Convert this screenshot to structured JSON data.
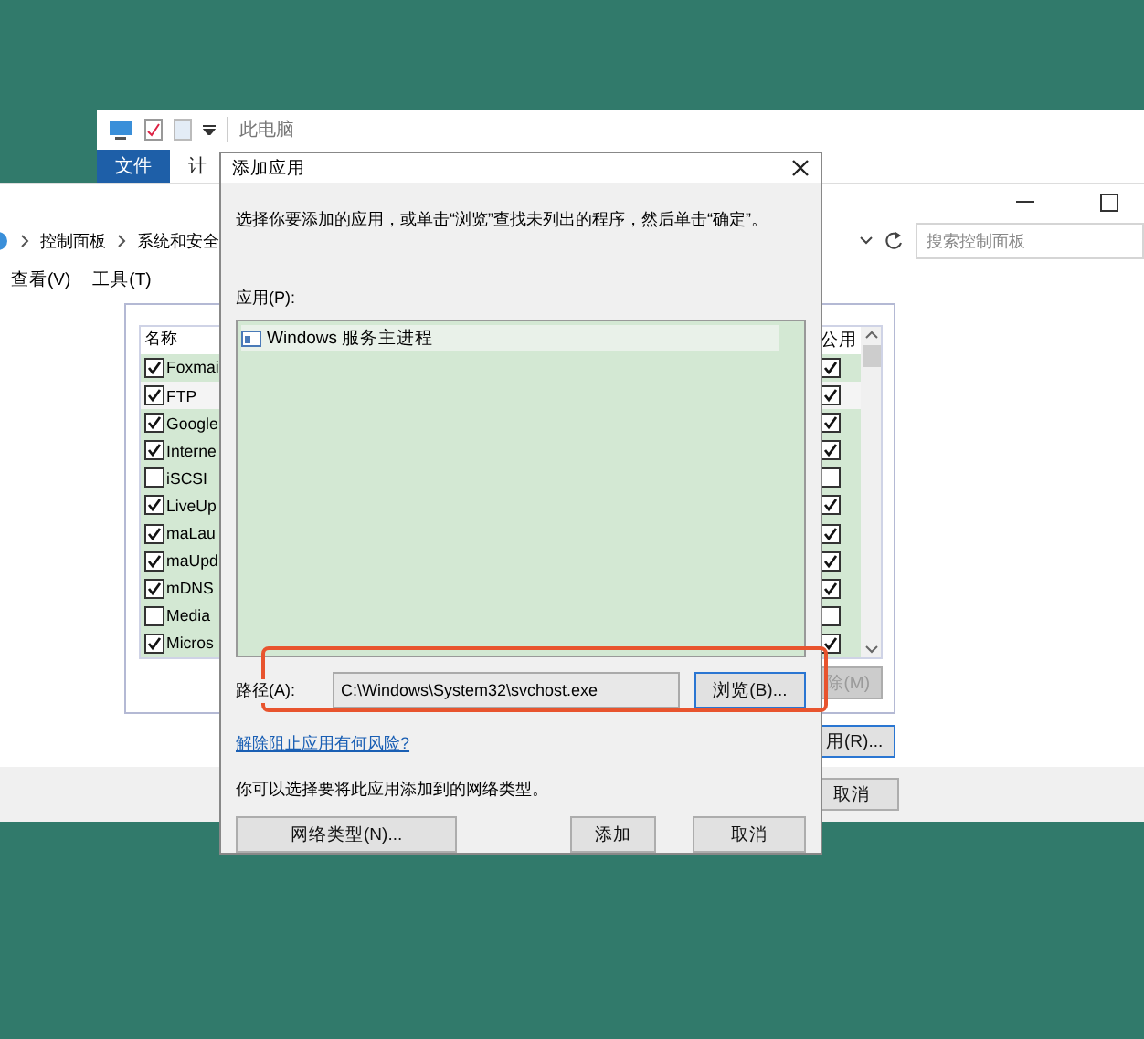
{
  "explorer_window": {
    "title": "此电脑",
    "ribbon_tabs": [
      {
        "label": "文件",
        "selected": true
      },
      {
        "label": "计",
        "selected": false
      }
    ]
  },
  "control_panel": {
    "breadcrumb": [
      "控制面板",
      "系统和安全"
    ],
    "search": {
      "placeholder": "搜索控制面板"
    },
    "menu": [
      "查看(V)",
      "工具(T)"
    ],
    "apps_table": {
      "columns": [
        "名称",
        "公用"
      ],
      "rows": [
        {
          "name": "Foxmai",
          "checked": true,
          "public": true,
          "selected": false
        },
        {
          "name": "FTP",
          "checked": true,
          "public": true,
          "selected": true
        },
        {
          "name": "Google",
          "checked": true,
          "public": true,
          "selected": false
        },
        {
          "name": "Interne",
          "checked": true,
          "public": true,
          "selected": false
        },
        {
          "name": "iSCSI",
          "checked": false,
          "public": false,
          "selected": false
        },
        {
          "name": "LiveUp",
          "checked": true,
          "public": true,
          "selected": false
        },
        {
          "name": "maLau",
          "checked": true,
          "public": true,
          "selected": false
        },
        {
          "name": "maUpd",
          "checked": true,
          "public": true,
          "selected": false
        },
        {
          "name": "mDNS",
          "checked": true,
          "public": true,
          "selected": false
        },
        {
          "name": "Media",
          "checked": false,
          "public": false,
          "selected": false
        },
        {
          "name": "Micros",
          "checked": true,
          "public": true,
          "selected": false
        }
      ]
    },
    "remove_button": {
      "label": "除(M)",
      "disabled": true
    },
    "allow_button": {
      "label": "用(R)...",
      "disabled": false
    },
    "cancel_button": "取消"
  },
  "dialog": {
    "title": "添加应用",
    "instruction": "选择你要添加的应用，或单击“浏览”查找未列出的程序，然后单击“确定”。",
    "apps_label": "应用(P):",
    "apps": [
      {
        "name": "Windows 服务主进程",
        "selected": true
      }
    ],
    "path_label": "路径(A):",
    "path_value": "C:\\Windows\\System32\\svchost.exe",
    "browse_button": "浏览(B)...",
    "risk_link": "解除阻止应用有何风险?",
    "network_hint": "你可以选择要将此应用添加到的网络类型。",
    "buttons": [
      "网络类型(N)...",
      "添加",
      "取消"
    ]
  }
}
